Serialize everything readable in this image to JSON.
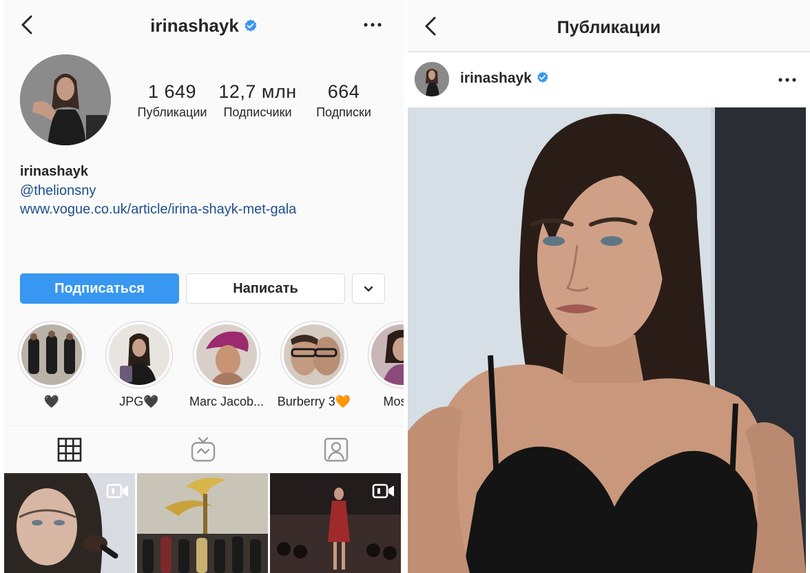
{
  "profile": {
    "username": "irinashayk",
    "verified": true,
    "stats": {
      "posts_count": "1 649",
      "posts_label": "Публикации",
      "followers_count": "12,7 млн",
      "followers_label": "Подписчики",
      "following_count": "664",
      "following_label": "Подписки"
    },
    "bio": {
      "name": "irinashayk",
      "mention": "@thelionsny",
      "link": "www.vogue.co.uk/article/irina-shayk-met-gala"
    },
    "buttons": {
      "follow": "Подписаться",
      "message": "Написать"
    },
    "highlights": [
      {
        "label": "🖤"
      },
      {
        "label": "JPG🖤"
      },
      {
        "label": "Marc Jacob..."
      },
      {
        "label": "Burberry 3🧡"
      },
      {
        "label": "Mosch"
      }
    ],
    "tabs": [
      "grid-icon",
      "igtv-icon",
      "tagged-icon"
    ],
    "grid": [
      {
        "type": "video"
      },
      {
        "type": "photo"
      },
      {
        "type": "video"
      }
    ]
  },
  "post_view": {
    "title": "Публикации",
    "username": "irinashayk",
    "verified": true
  },
  "colors": {
    "accent": "#3897f0",
    "link": "#1d4f8b",
    "verified_badge": "#3897f0"
  }
}
